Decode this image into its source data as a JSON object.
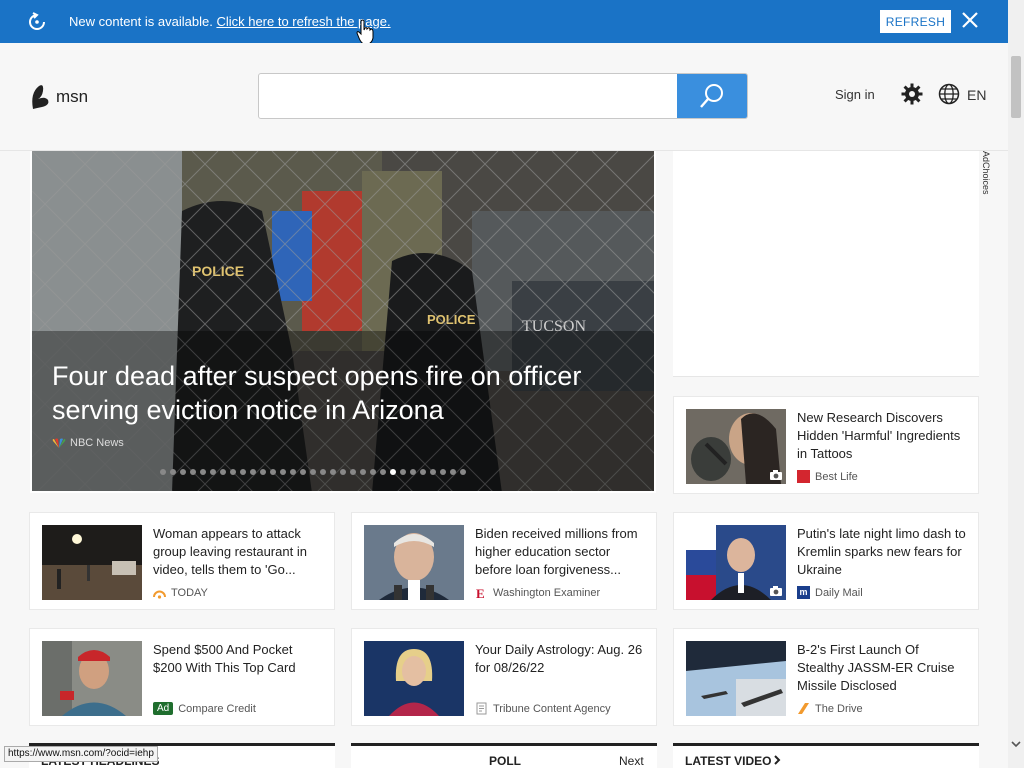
{
  "notification": {
    "message": "New content is available.",
    "link": "Click here to refresh the page.",
    "refresh_label": "REFRESH"
  },
  "header": {
    "logo_text": "msn",
    "search_value": "",
    "signin": "Sign in",
    "language": "EN"
  },
  "hero": {
    "headline": "Four dead after suspect opens fire on officer serving eviction notice in Arizona",
    "source": "NBC News",
    "slide_count": 31,
    "active_slide": 23
  },
  "ad": {
    "choices_label": "AdChoices"
  },
  "cards": [
    {
      "title": "New Research Discovers Hidden 'Harmful' Ingredients in Tattoos",
      "source": "Best Life",
      "thumb": "tattoo-photo",
      "logo": "bestlife-logo"
    },
    {
      "title": "Woman appears to attack group leaving restaurant in video, tells them to 'Go...",
      "source": "TODAY",
      "thumb": "night-street-photo",
      "logo": "today-logo"
    },
    {
      "title": "Biden received millions from higher education sector before loan forgiveness...",
      "source": "Washington Examiner",
      "thumb": "biden-photo",
      "logo": "washington-examiner-logo"
    },
    {
      "title": "Putin's late night limo dash to Kremlin sparks new fears for Ukraine",
      "source": "Daily Mail",
      "thumb": "putin-photo",
      "logo": "dailymail-logo"
    },
    {
      "title": "Spend $500 And Pocket $200 With This Top Card",
      "source": "Compare Credit",
      "ad_badge": "Ad",
      "thumb": "man-card-photo"
    },
    {
      "title": "Your Daily Astrology: Aug. 26 for 08/26/22",
      "source": "Tribune Content Agency",
      "thumb": "woman-photo",
      "logo": "tribune-logo"
    },
    {
      "title": "B-2's First Launch Of Stealthy JASSM-ER Cruise Missile Disclosed",
      "source": "The Drive",
      "thumb": "missile-photo",
      "logo": "thedrive-logo"
    }
  ],
  "bottom": {
    "latest_headlines": "LATEST HEADLINES",
    "poll": "POLL",
    "next": "Next",
    "latest_video": "LATEST VIDEO"
  },
  "status_url": "https://www.msn.com/?ocid=iehp",
  "colors": {
    "accent": "#1a73c6",
    "search_button": "#3a8fde"
  }
}
